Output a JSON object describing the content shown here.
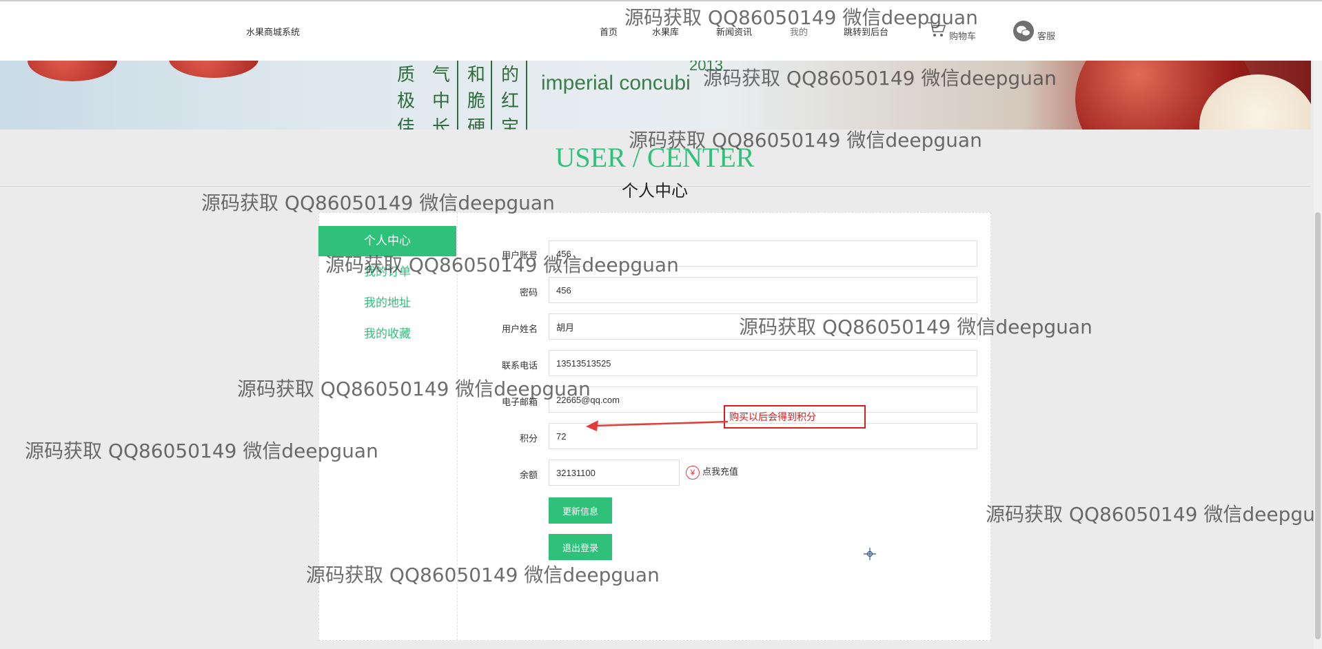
{
  "brand": "水果商城系统",
  "nav": {
    "items": [
      {
        "label": "首页"
      },
      {
        "label": "水果库"
      },
      {
        "label": "新闻资讯"
      },
      {
        "label": "我的"
      },
      {
        "label": "跳转到后台"
      }
    ],
    "cart": "购物车",
    "service": "客服"
  },
  "banner": {
    "poem_cols": [
      "质极佳",
      "气中长",
      "和脆硬",
      "的红宝"
    ],
    "text_en": "imperial concubi",
    "year": "2013"
  },
  "center": {
    "title": "USER / CENTER",
    "subtitle": "个人中心"
  },
  "sidebar": {
    "items": [
      {
        "label": "个人中心",
        "active": true
      },
      {
        "label": "我的订单"
      },
      {
        "label": "我的地址"
      },
      {
        "label": "我的收藏"
      }
    ]
  },
  "form": {
    "account": {
      "label": "用户账号",
      "value": "456"
    },
    "password": {
      "label": "密码",
      "value": "456"
    },
    "name": {
      "label": "用户姓名",
      "value": "胡月"
    },
    "phone": {
      "label": "联系电话",
      "value": "13513513525"
    },
    "email": {
      "label": "电子邮箱",
      "value": "22665@qq.com"
    },
    "points": {
      "label": "积分",
      "value": "72"
    },
    "balance": {
      "label": "余额",
      "value": "32131100"
    },
    "recharge": "点我充值",
    "recharge_icon": "¥",
    "update_btn": "更新信息",
    "logout_btn": "退出登录"
  },
  "annotation": "购买以后会得到积分",
  "watermark": "源码获取 QQ86050149 微信deepguan",
  "colors": {
    "accent": "#2fc17a",
    "annotation": "#d71d1d"
  }
}
